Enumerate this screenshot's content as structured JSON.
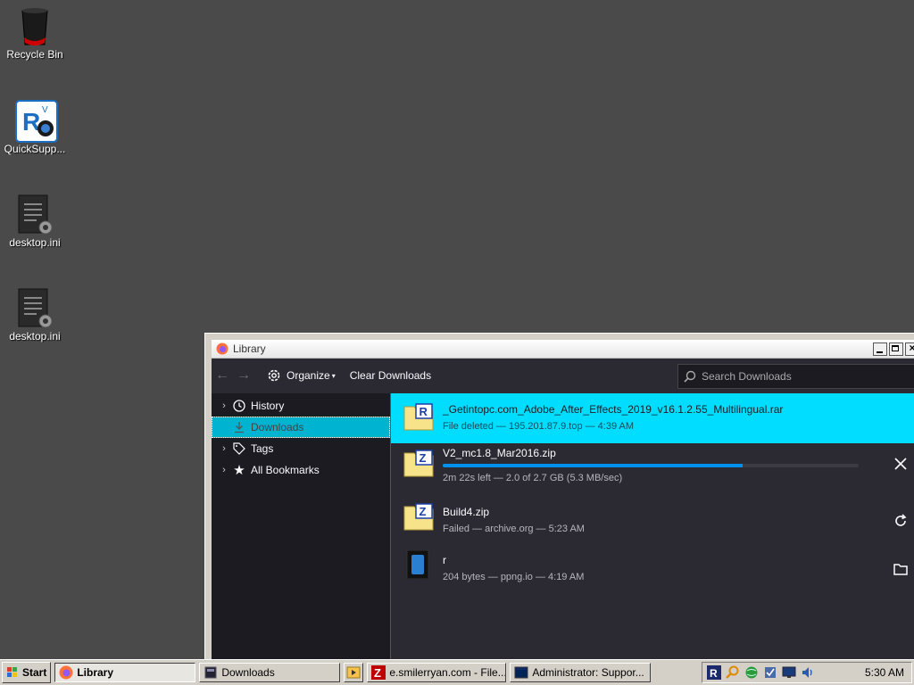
{
  "desktop": {
    "icons": [
      {
        "label": "Recycle Bin"
      },
      {
        "label": "QuickSupp..."
      },
      {
        "label": "desktop.ini"
      },
      {
        "label": "desktop.ini"
      }
    ]
  },
  "window": {
    "title": "Library",
    "toolbar": {
      "back_icon": "arrow-left-icon",
      "forward_icon": "arrow-right-icon",
      "organize_label": "Organize",
      "clear_downloads_label": "Clear Downloads",
      "search_placeholder": "Search Downloads"
    },
    "sidebar": {
      "items": [
        {
          "label": "History",
          "icon": "clock-icon",
          "expandable": true
        },
        {
          "label": "Downloads",
          "icon": "download-icon",
          "selected": true
        },
        {
          "label": "Tags",
          "icon": "tag-icon",
          "expandable": true
        },
        {
          "label": "All Bookmarks",
          "icon": "star-icon",
          "expandable": true
        }
      ]
    },
    "downloads": [
      {
        "name": "_Getintopc.com_Adobe_After_Effects_2019_v16.1.2.55_Multilingual.rar",
        "status": "File deleted — 195.201.87.9.top — 4:39 AM",
        "icon_letter": "R",
        "selected": true
      },
      {
        "name": "V2_mc1.8_Mar2016.zip",
        "status": "2m 22s left — 2.0 of 2.7 GB (5.3 MB/sec)",
        "icon_letter": "Z",
        "progress": 0.72,
        "action": "cancel-icon"
      },
      {
        "name": "Build4.zip",
        "status": "Failed — archive.org — 5:23 AM",
        "icon_letter": "Z",
        "action": "retry-icon"
      },
      {
        "name": "r",
        "status": "204 bytes — ppng.io — 4:19 AM",
        "icon_letter": "",
        "action": "folder-icon"
      }
    ]
  },
  "taskbar": {
    "start_label": "Start",
    "tasks": [
      {
        "label": "Library",
        "active": true
      },
      {
        "label": "Downloads"
      },
      {
        "label": "e.smilerryan.com - File..."
      },
      {
        "label": "Administrator: Suppor..."
      }
    ],
    "clock": "5:30 AM"
  },
  "colors": {
    "accent_selection": "#00ddff",
    "progress": "#0090ed",
    "window_bg": "#2b2a33",
    "sidebar_bg": "#1c1b22"
  }
}
